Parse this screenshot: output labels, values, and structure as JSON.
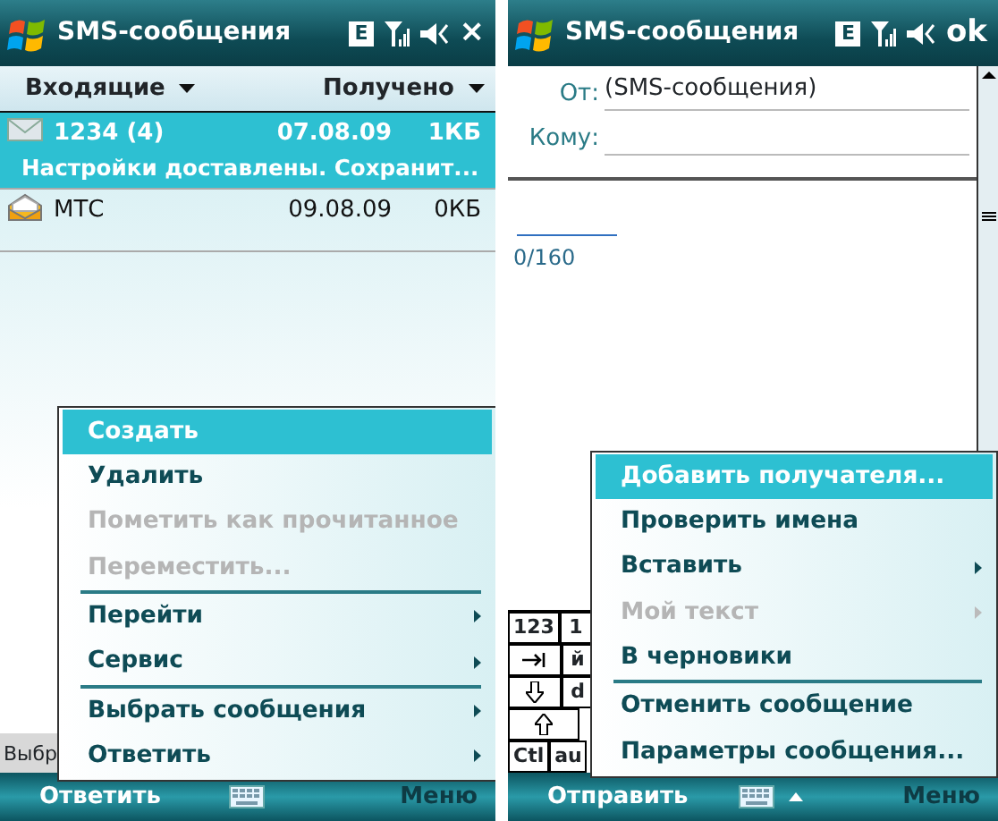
{
  "inbox_screen": {
    "title": "SMS-сообщения",
    "network_badge": "E",
    "title_action": "×",
    "folder": "Входящие",
    "sort": "Получено",
    "messages": [
      {
        "sender": "1234 (4)",
        "date": "07.08.09",
        "size": "1КБ",
        "preview": "Настройки доставлены. Сохранит...",
        "read": false,
        "selected": true
      },
      {
        "sender": "МТС",
        "date": "09.08.09",
        "size": "0КБ",
        "read": true,
        "selected": false
      }
    ],
    "status_text": "Выбр",
    "menu": [
      {
        "label": "Создать",
        "selected": true,
        "disabled": false,
        "submenu": false,
        "separator_before": false
      },
      {
        "label": "Удалить",
        "selected": false,
        "disabled": false,
        "submenu": false,
        "separator_before": false
      },
      {
        "label": "Пометить как прочитанное",
        "selected": false,
        "disabled": true,
        "submenu": false,
        "separator_before": false
      },
      {
        "label": "Переместить...",
        "selected": false,
        "disabled": true,
        "submenu": false,
        "separator_before": false
      },
      {
        "label": "Перейти",
        "selected": false,
        "disabled": false,
        "submenu": true,
        "separator_before": true
      },
      {
        "label": "Сервис",
        "selected": false,
        "disabled": false,
        "submenu": true,
        "separator_before": false
      },
      {
        "label": "Выбрать сообщения",
        "selected": false,
        "disabled": false,
        "submenu": true,
        "separator_before": true
      },
      {
        "label": "Ответить",
        "selected": false,
        "disabled": false,
        "submenu": true,
        "separator_before": false
      }
    ],
    "softkeys": {
      "left": "Ответить",
      "right": "Меню",
      "input_caret": false
    }
  },
  "compose_screen": {
    "title": "SMS-сообщения",
    "network_badge": "E",
    "title_action": "ok",
    "from_label": "От:",
    "from_value": "(SMS-сообщения)",
    "to_label": "Кому:",
    "counter": "0/160",
    "keyboard_rows": [
      [
        {
          "kind": "text",
          "label": "123"
        },
        {
          "kind": "text",
          "label": "1"
        }
      ],
      [
        {
          "kind": "tab"
        },
        {
          "kind": "text",
          "label": "й"
        }
      ],
      [
        {
          "kind": "caps"
        },
        {
          "kind": "text",
          "label": "d"
        }
      ],
      [
        {
          "kind": "shift"
        }
      ],
      [
        {
          "kind": "text",
          "label": "Ctl"
        },
        {
          "kind": "text",
          "label": "au"
        }
      ]
    ],
    "menu": [
      {
        "label": "Добавить получателя...",
        "selected": true,
        "disabled": false,
        "submenu": false,
        "separator_before": false
      },
      {
        "label": "Проверить имена",
        "selected": false,
        "disabled": false,
        "submenu": false,
        "separator_before": false
      },
      {
        "label": "Вставить",
        "selected": false,
        "disabled": false,
        "submenu": true,
        "separator_before": false
      },
      {
        "label": "Мой текст",
        "selected": false,
        "disabled": true,
        "submenu": true,
        "separator_before": false
      },
      {
        "label": "В черновики",
        "selected": false,
        "disabled": false,
        "submenu": false,
        "separator_before": false
      },
      {
        "label": "Отменить сообщение",
        "selected": false,
        "disabled": false,
        "submenu": false,
        "separator_before": true
      },
      {
        "label": "Параметры сообщения...",
        "selected": false,
        "disabled": false,
        "submenu": false,
        "separator_before": false
      }
    ],
    "softkeys": {
      "left": "Отправить",
      "right": "Меню",
      "input_caret": true
    }
  }
}
